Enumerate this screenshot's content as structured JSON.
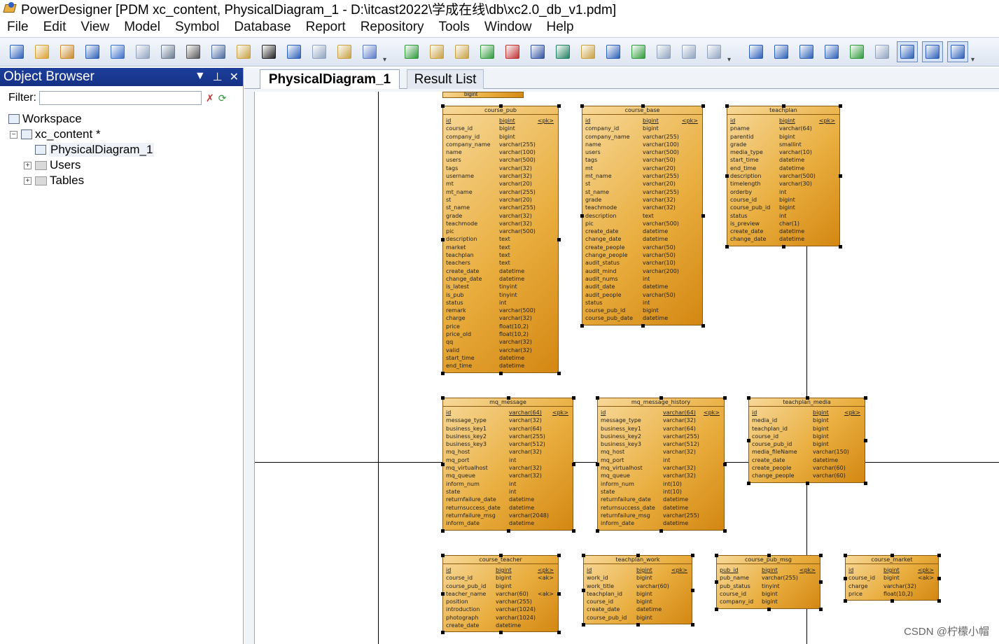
{
  "window": {
    "title": "PowerDesigner [PDM xc_content, PhysicalDiagram_1 - D:\\itcast2022\\学成在线\\db\\xc2.0_db_v1.pdm]"
  },
  "menu": [
    "File",
    "Edit",
    "View",
    "Model",
    "Symbol",
    "Database",
    "Report",
    "Repository",
    "Tools",
    "Window",
    "Help"
  ],
  "toolbar": {
    "icons": [
      "new-icon",
      "open-model-icon",
      "open-folder-icon",
      "save-icon",
      "save-all-icon",
      "print-preview-icon",
      "print-icon",
      "cut-icon",
      "copy-icon",
      "paste-icon",
      "delete-icon",
      "undo-icon",
      "redo-icon",
      "properties-icon",
      "generate-icon",
      "new-package-icon",
      "open-package-icon",
      "find-icon",
      "refresh-icon",
      "check-model-icon",
      "shadow-icon",
      "text-tool-icon",
      "brush-icon",
      "format-icon",
      "font-icon",
      "align-icon",
      "back-icon",
      "forward-icon",
      "list-icon",
      "table-view-icon",
      "doc-view-icon",
      "split-view-icon",
      "report-icon",
      "hide-icon",
      "browser-icon",
      "output-icon",
      "result-icon"
    ],
    "colors": {
      "accent": "#1c3f9c",
      "icon_blue": "#2b5fb8",
      "icon_gold": "#d8a030",
      "icon_green": "#2e9a3a",
      "icon_red": "#c03030"
    }
  },
  "object_browser": {
    "title": "Object Browser",
    "filter_label": "Filter:",
    "filter_value": "",
    "tree": {
      "workspace": "Workspace",
      "model": "xc_content *",
      "diagram": "PhysicalDiagram_1",
      "users": "Users",
      "tables": "Tables"
    }
  },
  "tabs": {
    "active": "PhysicalDiagram_1",
    "inactive": "Result List"
  },
  "top_fragment": "bigint",
  "tables": [
    {
      "name": "course_pub",
      "rows": [
        [
          "id",
          "bigint",
          "<pk>"
        ],
        [
          "course_id",
          "bigint",
          ""
        ],
        [
          "company_id",
          "bigint",
          ""
        ],
        [
          "company_name",
          "varchar(255)",
          ""
        ],
        [
          "name",
          "varchar(100)",
          ""
        ],
        [
          "users",
          "varchar(500)",
          ""
        ],
        [
          "tags",
          "varchar(32)",
          ""
        ],
        [
          "username",
          "varchar(32)",
          ""
        ],
        [
          "mt",
          "varchar(20)",
          ""
        ],
        [
          "mt_name",
          "varchar(255)",
          ""
        ],
        [
          "st",
          "varchar(20)",
          ""
        ],
        [
          "st_name",
          "varchar(255)",
          ""
        ],
        [
          "grade",
          "varchar(32)",
          ""
        ],
        [
          "teachmode",
          "varchar(32)",
          ""
        ],
        [
          "pic",
          "varchar(500)",
          ""
        ],
        [
          "description",
          "text",
          ""
        ],
        [
          "market",
          "text",
          ""
        ],
        [
          "teachplan",
          "text",
          ""
        ],
        [
          "teachers",
          "text",
          ""
        ],
        [
          "create_date",
          "datetime",
          ""
        ],
        [
          "change_date",
          "datetime",
          ""
        ],
        [
          "is_latest",
          "tinyint",
          ""
        ],
        [
          "is_pub",
          "tinyint",
          ""
        ],
        [
          "status",
          "int",
          ""
        ],
        [
          "remark",
          "varchar(500)",
          ""
        ],
        [
          "charge",
          "varchar(32)",
          ""
        ],
        [
          "price",
          "float(10,2)",
          ""
        ],
        [
          "price_old",
          "float(10,2)",
          ""
        ],
        [
          "qq",
          "varchar(32)",
          ""
        ],
        [
          "valid",
          "varchar(32)",
          ""
        ],
        [
          "start_time",
          "datetime",
          ""
        ],
        [
          "end_time",
          "datetime",
          ""
        ]
      ]
    },
    {
      "name": "course_base",
      "rows": [
        [
          "id",
          "bigint",
          "<pk>"
        ],
        [
          "company_id",
          "bigint",
          ""
        ],
        [
          "company_name",
          "varchar(255)",
          ""
        ],
        [
          "name",
          "varchar(100)",
          ""
        ],
        [
          "users",
          "varchar(500)",
          ""
        ],
        [
          "tags",
          "varchar(50)",
          ""
        ],
        [
          "mt",
          "varchar(20)",
          ""
        ],
        [
          "mt_name",
          "varchar(255)",
          ""
        ],
        [
          "st",
          "varchar(20)",
          ""
        ],
        [
          "st_name",
          "varchar(255)",
          ""
        ],
        [
          "grade",
          "varchar(32)",
          ""
        ],
        [
          "teachmode",
          "varchar(32)",
          ""
        ],
        [
          "description",
          "text",
          ""
        ],
        [
          "pic",
          "varchar(500)",
          ""
        ],
        [
          "create_date",
          "datetime",
          ""
        ],
        [
          "change_date",
          "datetime",
          ""
        ],
        [
          "create_people",
          "varchar(50)",
          ""
        ],
        [
          "change_people",
          "varchar(50)",
          ""
        ],
        [
          "audit_status",
          "varchar(10)",
          ""
        ],
        [
          "audit_mind",
          "varchar(200)",
          ""
        ],
        [
          "audit_nums",
          "int",
          ""
        ],
        [
          "audit_date",
          "datetime",
          ""
        ],
        [
          "audit_people",
          "varchar(50)",
          ""
        ],
        [
          "status",
          "int",
          ""
        ],
        [
          "course_pub_id",
          "bigint",
          ""
        ],
        [
          "course_pub_date",
          "datetime",
          ""
        ]
      ]
    },
    {
      "name": "teachplan",
      "rows": [
        [
          "id",
          "bigint",
          "<pk>"
        ],
        [
          "pname",
          "varchar(64)",
          ""
        ],
        [
          "parentid",
          "bigint",
          ""
        ],
        [
          "grade",
          "smallint",
          ""
        ],
        [
          "media_type",
          "varchar(10)",
          ""
        ],
        [
          "start_time",
          "datetime",
          ""
        ],
        [
          "end_time",
          "datetime",
          ""
        ],
        [
          "description",
          "varchar(500)",
          ""
        ],
        [
          "timelength",
          "varchar(30)",
          ""
        ],
        [
          "orderby",
          "int",
          ""
        ],
        [
          "course_id",
          "bigint",
          ""
        ],
        [
          "course_pub_id",
          "bigint",
          ""
        ],
        [
          "status",
          "int",
          ""
        ],
        [
          "is_preview",
          "char(1)",
          ""
        ],
        [
          "create_date",
          "datetime",
          ""
        ],
        [
          "change_date",
          "datetime",
          ""
        ]
      ]
    },
    {
      "name": "mq_message",
      "rows": [
        [
          "id",
          "varchar(64)",
          "<pk>"
        ],
        [
          "message_type",
          "varchar(32)",
          ""
        ],
        [
          "business_key1",
          "varchar(64)",
          ""
        ],
        [
          "business_key2",
          "varchar(255)",
          ""
        ],
        [
          "business_key3",
          "varchar(512)",
          ""
        ],
        [
          "mq_host",
          "varchar(32)",
          ""
        ],
        [
          "mq_port",
          "int",
          ""
        ],
        [
          "mq_virtualhost",
          "varchar(32)",
          ""
        ],
        [
          "mq_queue",
          "varchar(32)",
          ""
        ],
        [
          "inform_num",
          "int",
          ""
        ],
        [
          "state",
          "int",
          ""
        ],
        [
          "returnfailure_date",
          "datetime",
          ""
        ],
        [
          "returnsuccess_date",
          "datetime",
          ""
        ],
        [
          "returnfailure_msg",
          "varchar(2048)",
          ""
        ],
        [
          "inform_date",
          "datetime",
          ""
        ]
      ]
    },
    {
      "name": "mq_message_history",
      "rows": [
        [
          "id",
          "varchar(64)",
          "<pk>"
        ],
        [
          "message_type",
          "varchar(32)",
          ""
        ],
        [
          "business_key1",
          "varchar(64)",
          ""
        ],
        [
          "business_key2",
          "varchar(255)",
          ""
        ],
        [
          "business_key3",
          "varchar(512)",
          ""
        ],
        [
          "mq_host",
          "varchar(32)",
          ""
        ],
        [
          "mq_port",
          "int",
          ""
        ],
        [
          "mq_virtualhost",
          "varchar(32)",
          ""
        ],
        [
          "mq_queue",
          "varchar(32)",
          ""
        ],
        [
          "inform_num",
          "int(10)",
          ""
        ],
        [
          "state",
          "int(10)",
          ""
        ],
        [
          "returnfailure_date",
          "datetime",
          ""
        ],
        [
          "returnsuccess_date",
          "datetime",
          ""
        ],
        [
          "returnfailure_msg",
          "varchar(255)",
          ""
        ],
        [
          "inform_date",
          "datetime",
          ""
        ]
      ]
    },
    {
      "name": "teachplan_media",
      "rows": [
        [
          "id",
          "bigint",
          "<pk>"
        ],
        [
          "media_id",
          "bigint",
          ""
        ],
        [
          "teachplan_id",
          "bigint",
          ""
        ],
        [
          "course_id",
          "bigint",
          ""
        ],
        [
          "course_pub_id",
          "bigint",
          ""
        ],
        [
          "media_fileName",
          "varchar(150)",
          ""
        ],
        [
          "create_date",
          "datetime",
          ""
        ],
        [
          "create_people",
          "varchar(60)",
          ""
        ],
        [
          "change_people",
          "varchar(60)",
          ""
        ]
      ]
    },
    {
      "name": "course_teacher",
      "rows": [
        [
          "id",
          "bigint",
          "<pk>"
        ],
        [
          "course_id",
          "bigint",
          "<ak>"
        ],
        [
          "course_pub_id",
          "bigint",
          ""
        ],
        [
          "teacher_name",
          "varchar(60)",
          "<ak>"
        ],
        [
          "position",
          "varchar(255)",
          ""
        ],
        [
          "introduction",
          "varchar(1024)",
          ""
        ],
        [
          "photograph",
          "varchar(1024)",
          ""
        ],
        [
          "create_date",
          "datetime",
          ""
        ]
      ]
    },
    {
      "name": "teachplan_work",
      "rows": [
        [
          "id",
          "bigint",
          "<pk>"
        ],
        [
          "work_id",
          "bigint",
          ""
        ],
        [
          "work_title",
          "varchar(60)",
          ""
        ],
        [
          "teachplan_id",
          "bigint",
          ""
        ],
        [
          "course_id",
          "bigint",
          ""
        ],
        [
          "create_date",
          "datetime",
          ""
        ],
        [
          "course_pub_id",
          "bigint",
          ""
        ]
      ]
    },
    {
      "name": "course_pub_msg",
      "rows": [
        [
          "pub_id",
          "bigint",
          "<pk>"
        ],
        [
          "pub_name",
          "varchar(255)",
          ""
        ],
        [
          "pub_status",
          "tinyint",
          ""
        ],
        [
          "course_id",
          "bigint",
          ""
        ],
        [
          "company_id",
          "bigint",
          ""
        ]
      ]
    },
    {
      "name": "course_market",
      "rows": [
        [
          "id",
          "bigint",
          "<pk>"
        ],
        [
          "course_id",
          "bigint",
          "<ak>"
        ],
        [
          "charge",
          "varchar(32)",
          ""
        ],
        [
          "price",
          "float(10,2)",
          ""
        ]
      ]
    }
  ],
  "watermark": "CSDN @柠檬小帽"
}
